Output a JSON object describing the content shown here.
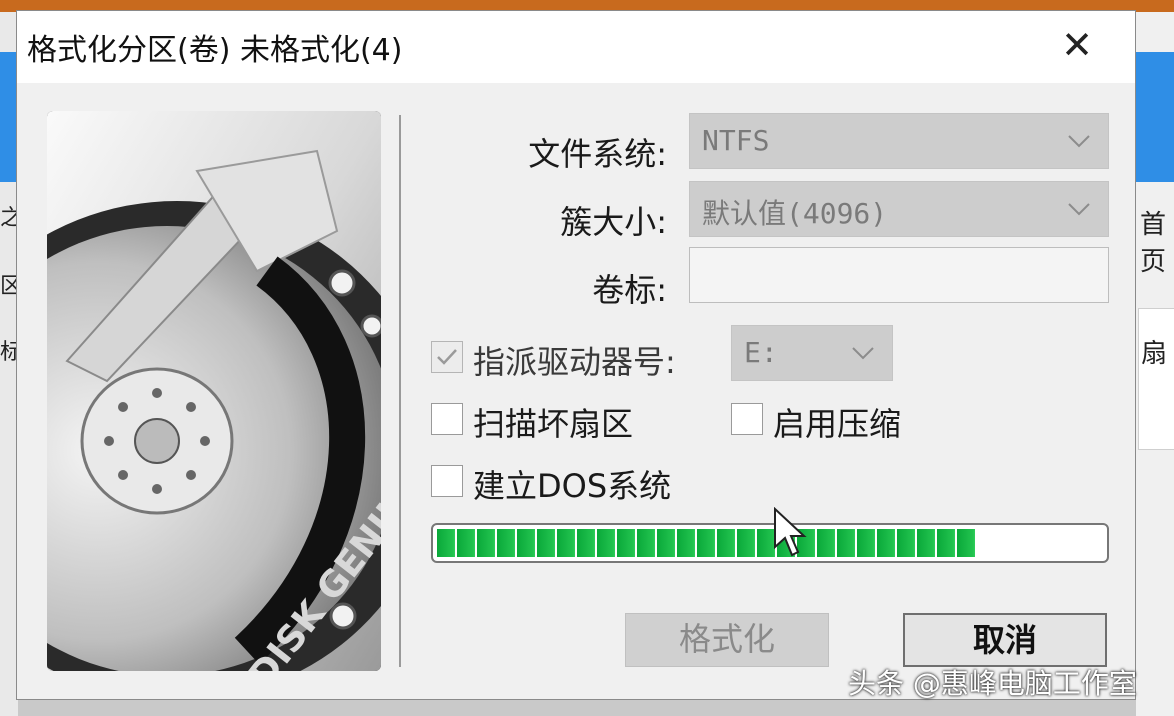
{
  "background": {
    "left_fragments": [
      "之",
      "区",
      "标"
    ],
    "right_fragments": [
      "首页",
      "扇"
    ]
  },
  "dialog": {
    "title": "格式化分区(卷) 未格式化(4)",
    "close_icon": "close-icon",
    "image_text": "DISK GENIUS",
    "file_system": {
      "label": "文件系统:",
      "value": "NTFS"
    },
    "cluster_size": {
      "label": "簇大小:",
      "value": "默认值(4096)"
    },
    "volume_label": {
      "label": "卷标:",
      "value": ""
    },
    "assign_drive": {
      "label": "指派驱动器号:",
      "checked": true,
      "value": "E:"
    },
    "scan_bad_sectors": {
      "label": "扫描坏扇区",
      "checked": false
    },
    "enable_compression": {
      "label": "启用压缩",
      "checked": false
    },
    "create_dos": {
      "label": "建立DOS系统",
      "checked": false
    },
    "progress": {
      "percent": 81,
      "color": "#1fbf4a"
    },
    "buttons": {
      "format": "格式化",
      "cancel": "取消"
    }
  },
  "watermark": "头条 @惠峰电脑工作室"
}
